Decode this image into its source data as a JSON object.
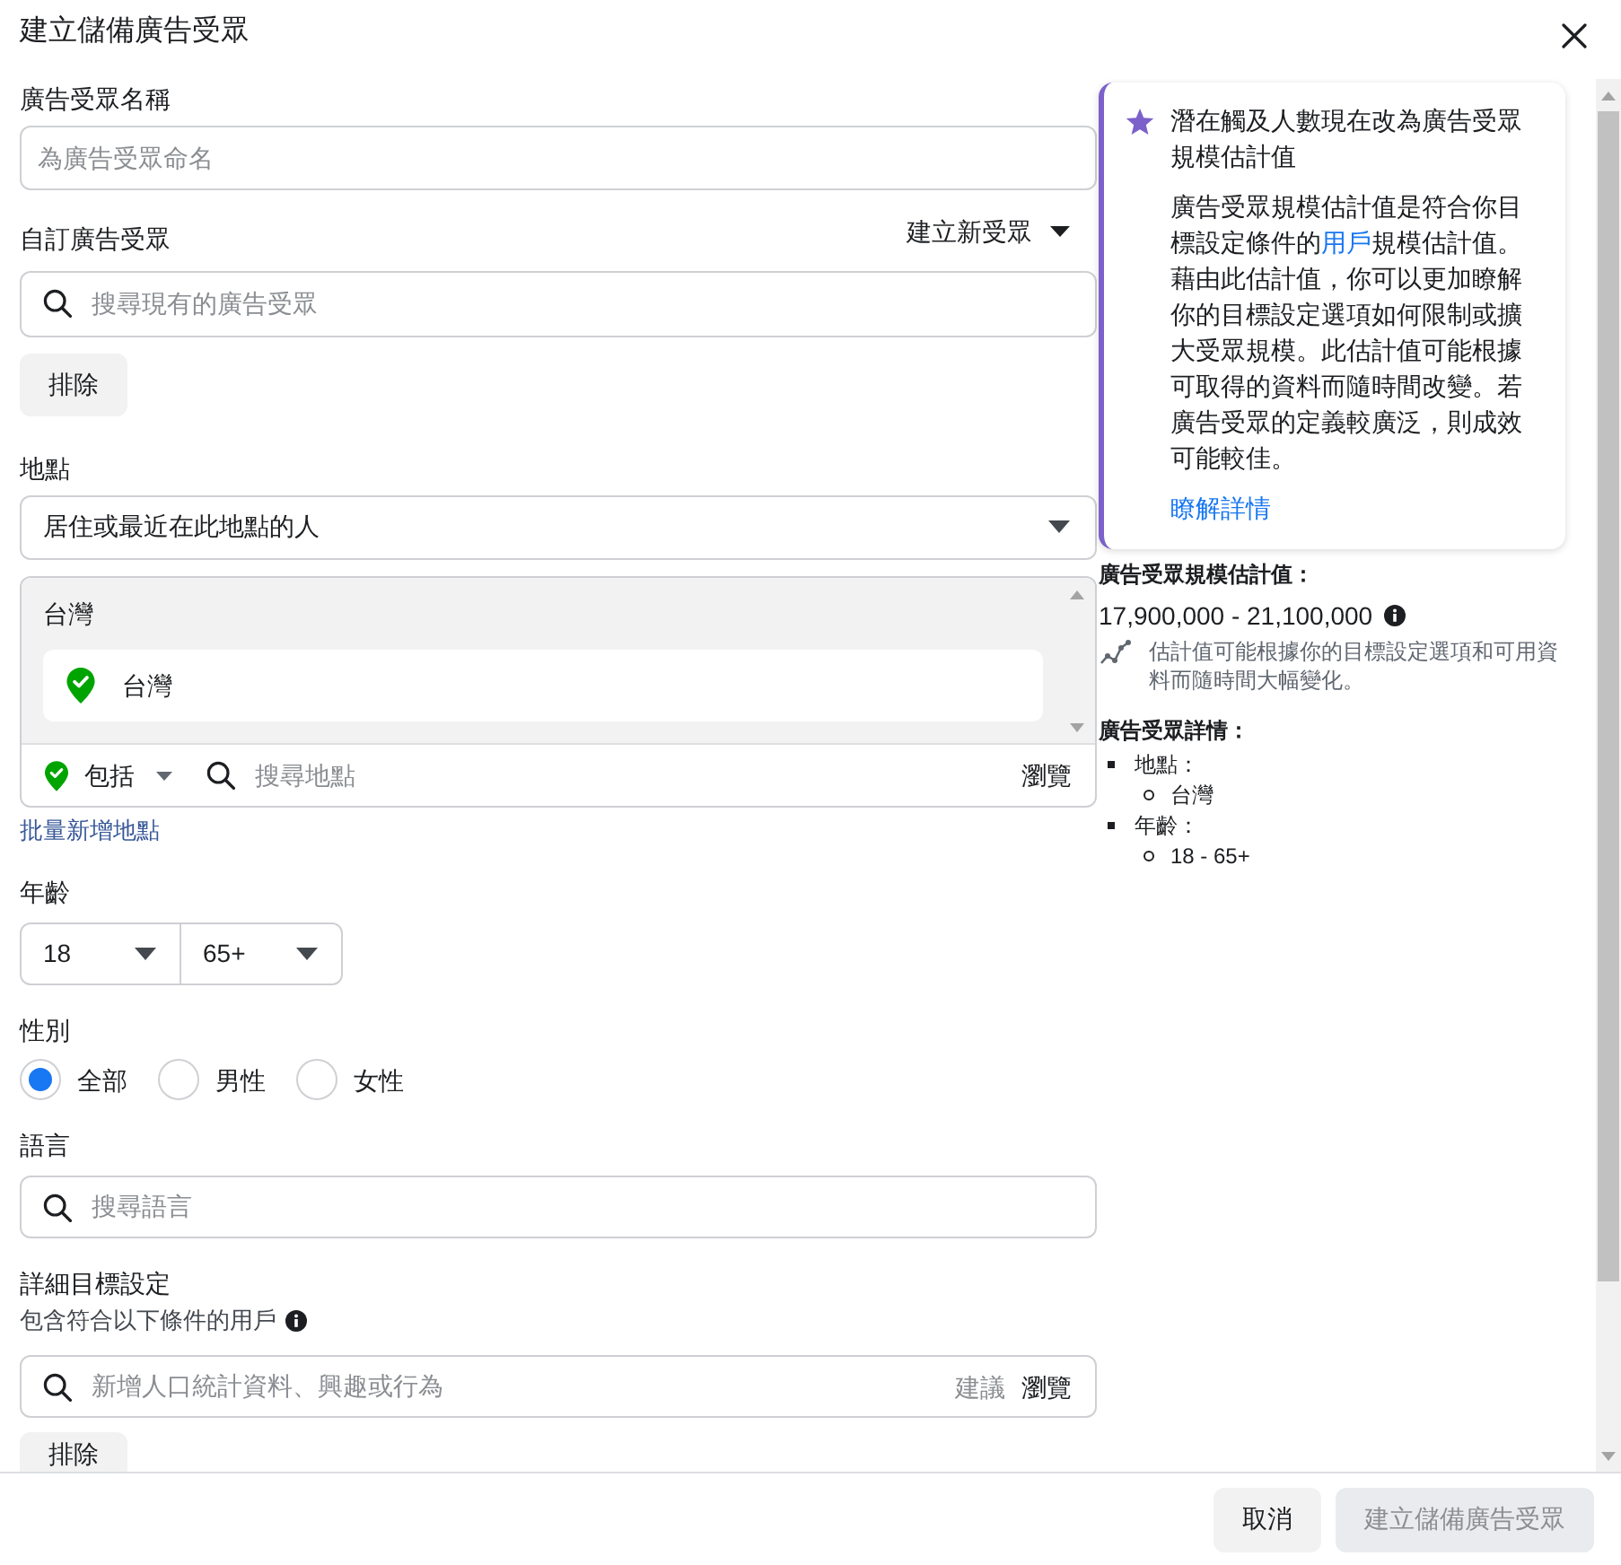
{
  "dialog": {
    "title": "建立儲備廣告受眾"
  },
  "audience_name": {
    "label": "廣告受眾名稱",
    "placeholder": "為廣告受眾命名"
  },
  "custom_audience": {
    "label": "自訂廣告受眾",
    "create_menu": "建立新受眾",
    "placeholder": "搜尋現有的廣告受眾",
    "exclude_button": "排除"
  },
  "location": {
    "label": "地點",
    "mode": "居住或最近在此地點的人",
    "groups": [
      {
        "heading": "台灣",
        "items": [
          {
            "name": "台灣"
          }
        ]
      }
    ],
    "include_menu": "包括",
    "placeholder": "搜尋地點",
    "browse": "瀏覽",
    "bulk_add_link": "批量新增地點"
  },
  "age": {
    "label": "年齡",
    "min": "18",
    "max": "65+"
  },
  "gender": {
    "label": "性別",
    "options": [
      {
        "label": "全部",
        "selected": true
      },
      {
        "label": "男性",
        "selected": false
      },
      {
        "label": "女性",
        "selected": false
      }
    ]
  },
  "language": {
    "label": "語言",
    "placeholder": "搜尋語言"
  },
  "detailed_targeting": {
    "label": "詳細目標設定",
    "hint": "包含符合以下條件的用戶",
    "placeholder": "新增人口統計資料、興趣或行為",
    "suggestions": "建議",
    "browse": "瀏覽",
    "exclude_button": "排除"
  },
  "notice": {
    "title": "潛在觸及人數現在改為廣告受眾規模估計值",
    "body": [
      {
        "kind": "text",
        "text": "廣告受眾規模估計值是符合你目標設定條件的"
      },
      {
        "kind": "link",
        "text": "用戶"
      },
      {
        "kind": "text",
        "text": "規模估計值。藉由此估計值，你可以更加瞭解你的目標設定選項如何限制或擴大受眾規模。此估計值可能根據可取得的資料而隨時間改變。若廣告受眾的定義較廣泛，則成效可能較佳。"
      }
    ],
    "link": "瞭解詳情"
  },
  "estimate": {
    "label": "廣告受眾規模估計值：",
    "range": "17,900,000 - 21,100,000",
    "note": "估計值可能根據你的目標設定選項和可用資料而隨時間大幅變化。"
  },
  "details": {
    "label": "廣告受眾詳情：",
    "items": [
      {
        "label": "地點：",
        "children": [
          {
            "label": "台灣"
          }
        ]
      },
      {
        "label": "年齡：",
        "children": [
          {
            "label": "18 - 65+"
          }
        ]
      }
    ]
  },
  "footer": {
    "buttons": [
      {
        "label": "取消",
        "disabled": false
      },
      {
        "label": "建立儲備廣告受眾",
        "disabled": true
      }
    ]
  }
}
